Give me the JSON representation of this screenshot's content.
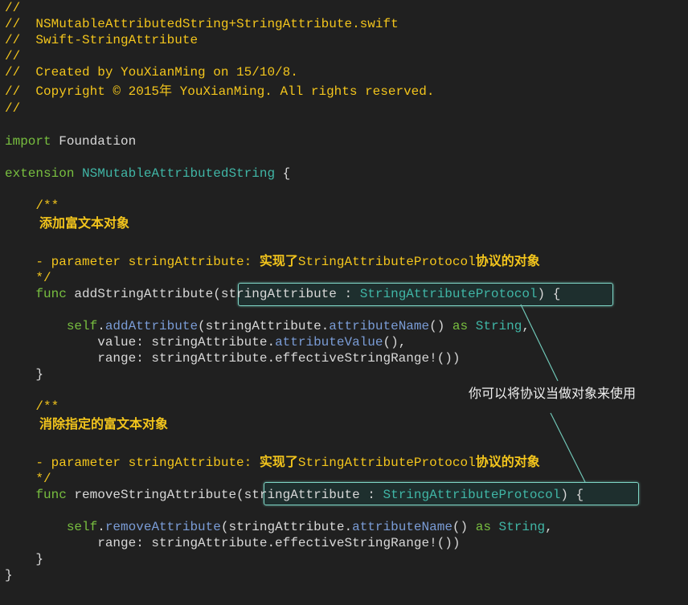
{
  "header": {
    "l1": "//",
    "l2": "//  NSMutableAttributedString+StringAttribute.swift",
    "l3": "//  Swift-StringAttribute",
    "l4": "//",
    "l5": "//  Created by YouXianMing on 15/10/8.",
    "l6": "//  Copyright © 2015年 YouXianMing. All rights reserved.",
    "l7": "//"
  },
  "import": {
    "keyword": "import",
    "module": " Foundation"
  },
  "extension": {
    "keyword": "extension",
    "type": " NSMutableAttributedString",
    "brace": " {"
  },
  "doc1": {
    "open": "    /**",
    "desc": "添加富文本对象",
    "param_prefix": "    - parameter stringAttribute: ",
    "param_zh1": "实现了",
    "param_proto": "StringAttributeProtocol",
    "param_zh2": "协议的对象",
    "close": "    */"
  },
  "func1": {
    "keyword": "    func",
    "name": " addStringAttribute",
    "param_name": "(stringAttribute : ",
    "param_type": "StringAttributeProtocol",
    "param_close": ")",
    "brace": " {",
    "body1_self": "        self",
    "body1_dot": ".",
    "body1_call": "addAttribute",
    "body1_open": "(stringAttribute.",
    "body1_prop": "attributeName",
    "body1_paren": "() ",
    "body1_as": "as",
    "body1_sp": " ",
    "body1_type": "String",
    "body1_end": ",",
    "body2_pre": "            value: stringAttribute.",
    "body2_prop": "attributeValue",
    "body2_end": "(),",
    "body3": "            range: stringAttribute.effectiveStringRange!())",
    "close": "    }"
  },
  "doc2": {
    "open": "    /**",
    "desc": "消除指定的富文本对象",
    "param_prefix": "    - parameter stringAttribute: ",
    "param_zh1": "实现了",
    "param_proto": "StringAttributeProtocol",
    "param_zh2": "协议的对象",
    "close": "    */"
  },
  "func2": {
    "keyword": "    func",
    "name": " removeStringAttribute",
    "param_name": "(stringAttribute : ",
    "param_type": "StringAttributeProtocol",
    "param_close": ")",
    "brace": " {",
    "body1_self": "        self",
    "body1_dot": ".",
    "body1_call": "removeAttribute",
    "body1_open": "(stringAttribute.",
    "body1_prop": "attributeName",
    "body1_paren": "() ",
    "body1_as": "as",
    "body1_sp": " ",
    "body1_type": "String",
    "body1_end": ",",
    "body2": "            range: stringAttribute.effectiveStringRange!())",
    "close": "    }"
  },
  "end_brace": "}",
  "annotation": "你可以将协议当做对象来使用",
  "colors": {
    "background": "#202020",
    "comment": "#f3c51c",
    "keyword": "#78bf3f",
    "type": "#40b6a6",
    "plain": "#d8d8d8",
    "highlight_border": "#7fd6c6"
  }
}
